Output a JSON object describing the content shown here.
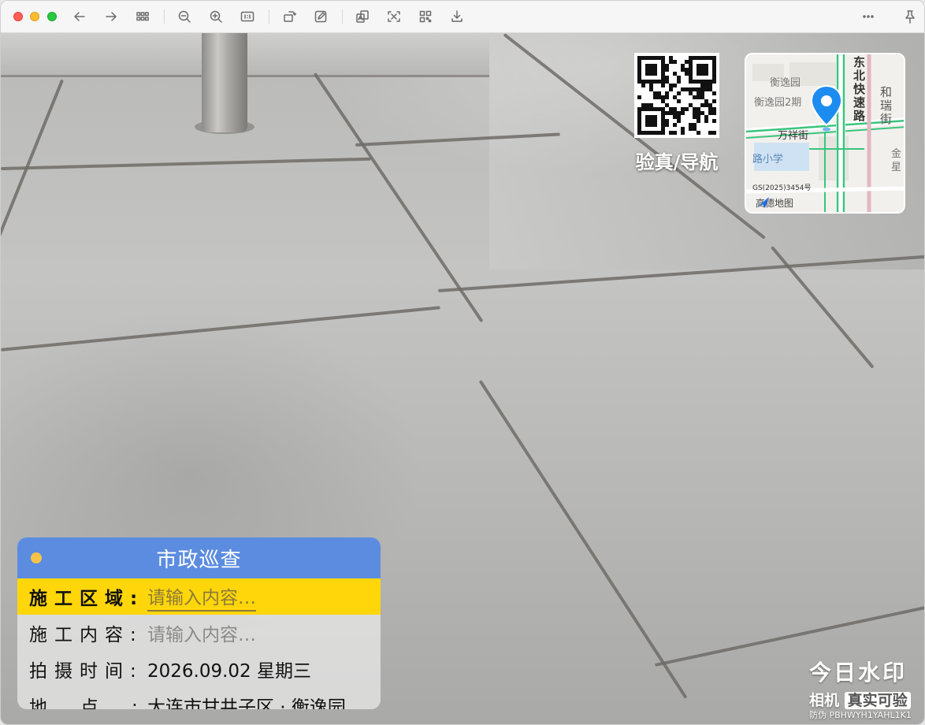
{
  "window": {
    "toolbar_icons": [
      "back-arrow-icon",
      "forward-arrow-icon",
      "grid-view-icon",
      "zoom-out-icon",
      "zoom-in-icon",
      "actual-size-icon",
      "rotate-icon",
      "edit-icon",
      "translate-icon",
      "scan-text-icon",
      "qr-code-icon",
      "save-icon",
      "more-icon",
      "pin-icon"
    ]
  },
  "qr": {
    "label": "验真/导航"
  },
  "map": {
    "labels": {
      "area1": "衡逸园",
      "area2": "衡逸园2期",
      "street": "万祥街",
      "school": "路小学",
      "road_vertical": [
        "东",
        "北",
        "快",
        "速",
        "路"
      ],
      "road_right": [
        "和",
        "瑞",
        "街"
      ],
      "right_edge": [
        "金",
        "星"
      ]
    },
    "license": "GS(2025)3454号",
    "brand": "高德地图",
    "pin_color": "#1c8cf0"
  },
  "card": {
    "title": "市政巡查",
    "header_color": "#5b8ce0",
    "highlight_color": "#ffd60a",
    "rows": [
      {
        "label": "施工区域:",
        "value": "请输入内容…",
        "placeholder": true,
        "highlight": true
      },
      {
        "label": "施工内容:",
        "value": "请输入内容…",
        "placeholder": true,
        "highlight": false
      },
      {
        "label": "拍摄时间:",
        "value": "2026.09.02 星期三",
        "placeholder": false,
        "highlight": false
      },
      {
        "label": "地点:",
        "value": "大连市甘井子区 · 衡逸园",
        "placeholder": false,
        "highlight": false
      }
    ]
  },
  "brand": {
    "top": "今日水印",
    "bottom_left": "相机",
    "bottom_right": "真实可验",
    "anti_fake": "防伪 PBHWYH1YAHL1K1"
  }
}
